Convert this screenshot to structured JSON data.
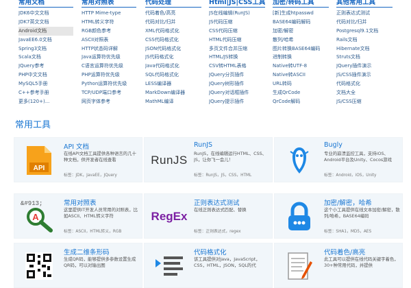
{
  "columns": [
    {
      "title": "常用文档",
      "items": [
        "JDK6中文文档",
        "JDK7英文文档",
        "Android文档",
        "JavaEE6.0文档",
        "Spring3文档",
        "Scala文档",
        "JQuery参考",
        "PHP中文文档",
        "MySQL5手册",
        "C++参考手册",
        "更多(120+)..."
      ],
      "selected": 2
    },
    {
      "title": "常用对照表",
      "items": [
        "HTTP Mime-type",
        "HTML转义字符",
        "RGB颜色参考",
        "ASCII对照表",
        "HTTP状态码详解",
        "Java运算符优先级",
        "C语言运算符优先级",
        "PHP运算符优先级",
        "Python运算符优先级",
        "TCP/UDP端口参考",
        "网页字体参考"
      ]
    },
    {
      "title": "代码处理",
      "items": [
        "代码着色/高亮",
        "代码对比/归并",
        "XML代码格式化",
        "CSS代码格式化",
        "JSON代码格式化",
        "JS代码格式化",
        "Java代码格式化",
        "SQL代码格式化",
        "LESS编译器",
        "MarkDown编译器",
        "MathML编译"
      ]
    },
    {
      "title": "Html|JS|CSS工具",
      "items": [
        "JS在线编辑(RunJS)",
        "JS代码压缩",
        "CSS代码压缩",
        "HTML代码压缩",
        "多页文件合并压缩",
        "HTML/JS转换",
        "CSV转HTML表格",
        "JQuery分页插件",
        "JQuery树形插件",
        "JQuery对话框插件",
        "JQuery提示插件"
      ]
    },
    {
      "title": "加密/转码工具",
      "items": [
        "[新]生成htpasswd",
        "BASE64编码解码",
        "加密/解密",
        "散列/哈希",
        "图片转换BASE64编码",
        "进制转换",
        "Native转UTF-8",
        "Native转ASCII",
        "URL转码",
        "生成QrCode",
        "QrCode解码"
      ]
    },
    {
      "title": "其他常用工具",
      "items": [
        "正则表达式测试",
        "代码对比/归并",
        "Postgresql9.1文档",
        "Rails文档",
        "Hibernate文档",
        "Struts文档",
        "JQuery插件演示",
        "JS/CSS插件演示",
        "代码格式化",
        "文档大全",
        "JS/CSS压缩"
      ]
    }
  ],
  "section_title": "常用工具",
  "cards": [
    {
      "name": "API 文档",
      "desc": "在线API文档工具提供各种语言的几十种文档，供开发者在线查看",
      "tags": "标签：JDK，JavaEE，JQuery",
      "icon": "api-doc-icon"
    },
    {
      "name": "RunJS",
      "desc": "RunJS，在线编辑运行HTML、CSS、JS，让你飞一会儿！",
      "tags": "标签：RunJS，JS，CSS，HTML",
      "icon": "runjs-logo",
      "logo_text": "RunJS"
    },
    {
      "name": "Bugly",
      "desc": "专业的崩溃监控工具，支持iOS、Android平台及Unity、Cocos游戏",
      "tags": "标签：Android，iOS，Unity",
      "icon": "bugly-bird-icon"
    },
    {
      "name": "常用对照表",
      "desc": "这里提供IT开发人员常用的对照表，比如ASCII、HTML转义字符",
      "tags": "标签：ASCII，HTML转义，RGB",
      "icon": "magnifier-icon",
      "icon_text": "&#913;"
    },
    {
      "name": "正则表达式测试",
      "desc": "在线正则表达式匹配、替换",
      "tags": "标签：正则表达式，regex",
      "icon": "regex-logo",
      "logo_text": "RegEx"
    },
    {
      "name": "加密/解密，哈希",
      "desc": "这个小工具提供在线文本加密/解密，散列/哈希，BASE64编码",
      "tags": "标签：SHA1，MD5，AES",
      "icon": "padlock-icon"
    },
    {
      "name": "生成二维条形码",
      "desc": "生成QR码，能够提供多参数设置生成QR码，可以对输出图",
      "tags": "",
      "icon": "qrcode-icon"
    },
    {
      "name": "代码格式化",
      "desc": "该工具提供对Java，JavaScript，CSS，HTML，JSON，SQL的代",
      "tags": "",
      "icon": "format-lines-icon"
    },
    {
      "name": "代码着色/高亮",
      "desc": "此工具可以提供在线代码关键字着色，30+种常用代码，并提供",
      "tags": "",
      "icon": "document-pen-icon"
    }
  ]
}
